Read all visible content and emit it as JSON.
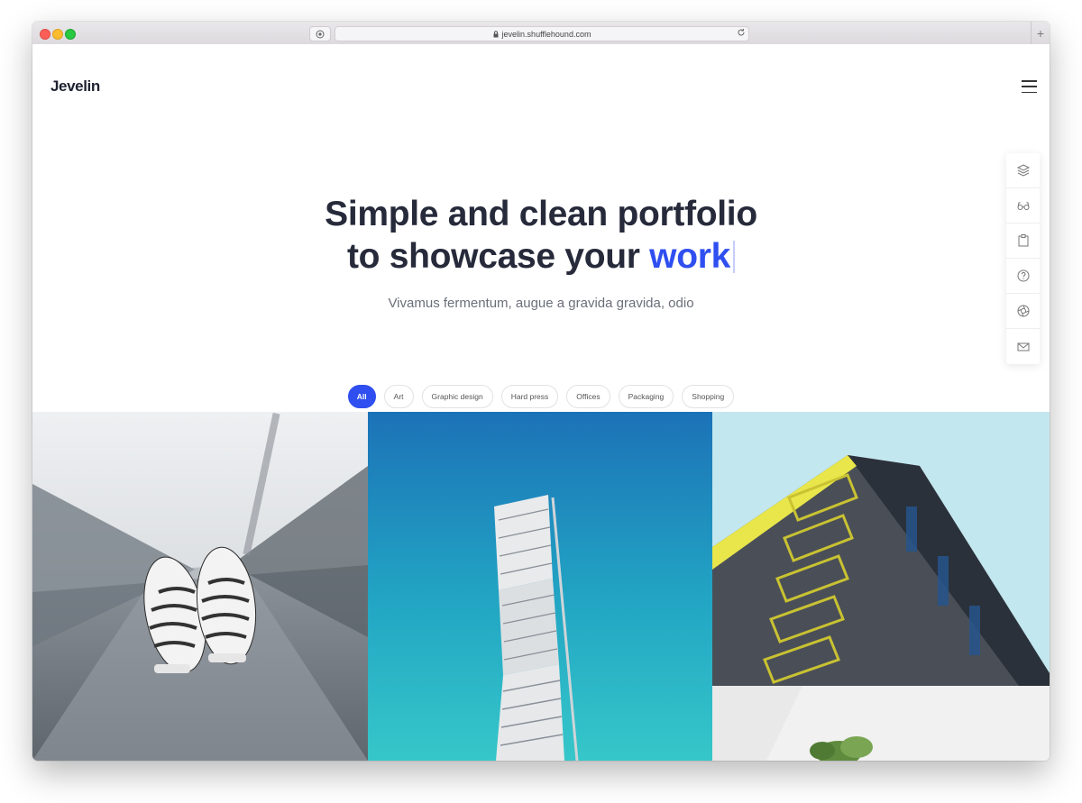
{
  "browser": {
    "url": "jevelin.shufflehound.com",
    "new_tab": "+"
  },
  "site": {
    "logo": "Jevelin"
  },
  "hero": {
    "title_line1": "Simple and clean portfolio",
    "title_line2_prefix": "to showcase your ",
    "title_line2_highlight": "work",
    "subtitle": "Vivamus fermentum, augue a gravida gravida, odio",
    "accent_color": "#2f4ff0"
  },
  "filters": [
    {
      "label": "All",
      "active": true
    },
    {
      "label": "Art"
    },
    {
      "label": "Graphic design"
    },
    {
      "label": "Hard press"
    },
    {
      "label": "Offices"
    },
    {
      "label": "Packaging"
    },
    {
      "label": "Shopping"
    }
  ],
  "side_dock": {
    "icons": [
      "layers-icon",
      "glasses-icon",
      "clipboard-icon",
      "help-circle-icon",
      "aperture-icon",
      "mail-icon"
    ]
  },
  "gallery": {
    "items": [
      "sneakers-photo",
      "twisting-tower-photo",
      "yellow-balconies-photo",
      "plant-photo"
    ]
  }
}
